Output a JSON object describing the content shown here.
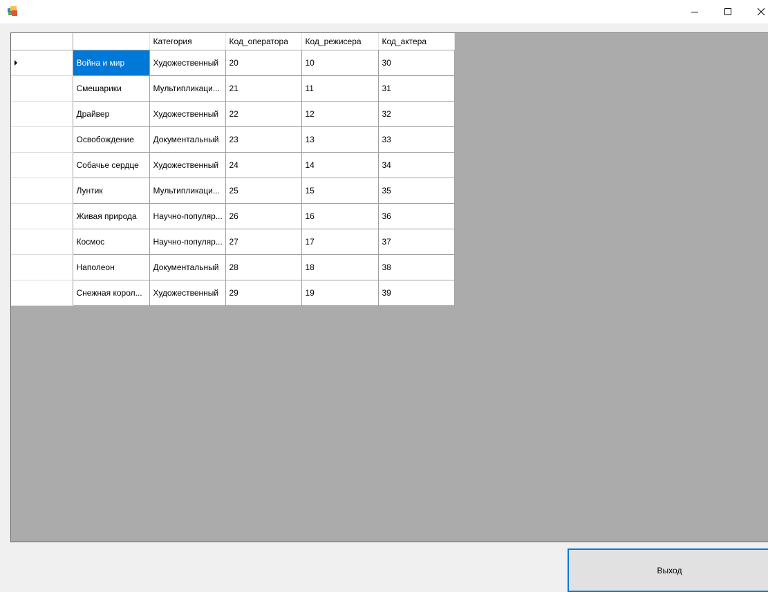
{
  "window": {
    "controls": [
      "minimize-icon",
      "maximize-icon",
      "close-icon"
    ]
  },
  "grid": {
    "columns": [
      "",
      "Категория",
      "Код_оператора",
      "Код_режисера",
      "Код_актера"
    ],
    "current_row": 0,
    "rows": [
      [
        "Война и мир",
        "Художественный",
        "20",
        "10",
        "30"
      ],
      [
        "Смешарики",
        "Мультипликаци...",
        "21",
        "11",
        "31"
      ],
      [
        "Драйвер",
        "Художественный",
        "22",
        "12",
        "32"
      ],
      [
        "Освобождение",
        "Документальный",
        "23",
        "13",
        "33"
      ],
      [
        "Собачье сердце",
        "Художественный",
        "24",
        "14",
        "34"
      ],
      [
        "Лунтик",
        "Мультипликаци...",
        "25",
        "15",
        "35"
      ],
      [
        "Живая природа",
        "Научно-популяр...",
        "26",
        "16",
        "36"
      ],
      [
        "Космос",
        "Научно-популяр...",
        "27",
        "17",
        "37"
      ],
      [
        "Наполеон",
        "Документальный",
        "28",
        "18",
        "38"
      ],
      [
        "Снежная корол...",
        "Художественный",
        "29",
        "19",
        "39"
      ]
    ]
  },
  "exit_button": {
    "label": "Выход"
  },
  "colors": {
    "selection": "#0078d7",
    "grid_background": "#ababab",
    "button_focus_border": "#0078d7"
  }
}
